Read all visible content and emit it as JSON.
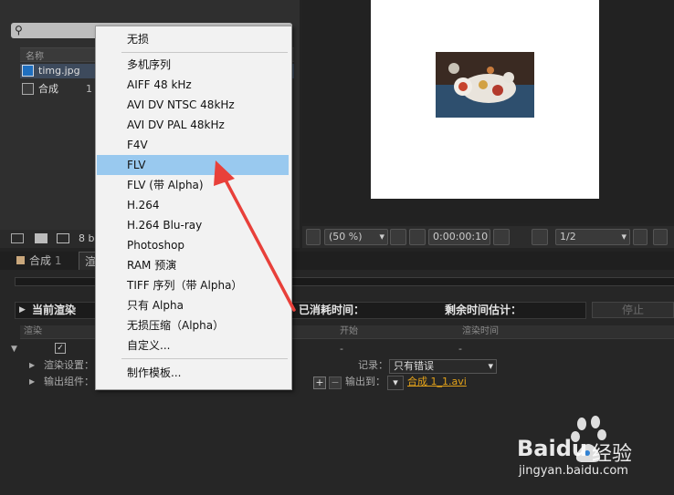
{
  "project": {
    "header_name": "名称",
    "items": [
      {
        "name": "timg.jpg",
        "num": ""
      },
      {
        "name": "合成",
        "num": "1"
      }
    ],
    "footer_text": "8 b"
  },
  "viewer": {
    "zoom": "(50 %)",
    "timecode": "0:00:00:10",
    "resolution": "1/2"
  },
  "tabs": {
    "comp": "合成",
    "comp_num": "1",
    "render": "渲"
  },
  "render_queue": {
    "current_render": "当前渲染",
    "elapsed": "已消耗时间：",
    "remaining": "剩余时间估计：",
    "stop": "停止",
    "columns": {
      "render": "渲染",
      "start": "开始",
      "render_time": "渲染时间"
    },
    "row_dash1": "-",
    "row_dash2": "-",
    "render_settings_label": "渲染设置：",
    "output_module_label": "输出组件：",
    "log_label": "记录：",
    "log_value": "只有错误",
    "output_to_label": "输出到：",
    "output_file": "合成 1_1.avi"
  },
  "menu": {
    "items": [
      "无损",
      "多机序列",
      "AIFF 48 kHz",
      "AVI DV NTSC 48kHz",
      "AVI DV PAL 48kHz",
      "F4V",
      "FLV",
      "FLV (带 Alpha)",
      "H.264",
      "H.264 Blu-ray",
      "Photoshop",
      "RAM 预演",
      "TIFF 序列（带 Alpha）",
      "只有 Alpha",
      "无损压缩（Alpha）",
      "自定义...",
      "制作模板..."
    ],
    "selected": "FLV"
  },
  "watermark": {
    "brand": "Bai",
    "brand2": "du",
    "product": "经验",
    "url": "jingyan.baidu.com"
  },
  "colors": {
    "accent": "#99c9ef",
    "arrow": "#e8403a",
    "link": "#e3a21a"
  }
}
